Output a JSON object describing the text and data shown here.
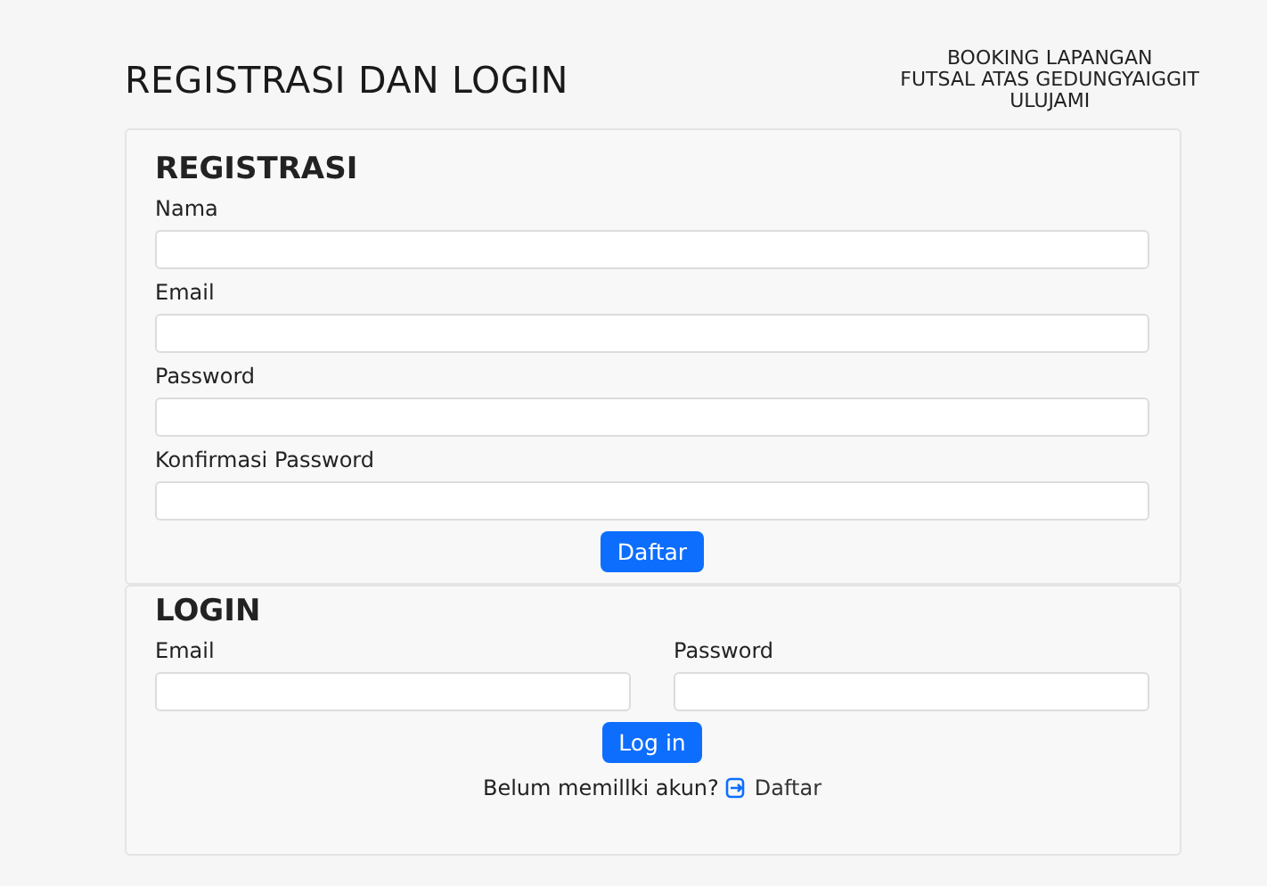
{
  "header": {
    "title": "REGISTRASI DAN LOGIN",
    "subtitle_lines": [
      "BOOKING LAPANGAN",
      "FUTSAL ATAS GEDUNGYAIGGIT",
      "ULUJAMI"
    ]
  },
  "registration": {
    "heading": "REGISTRASI",
    "fields": [
      {
        "label": "Nama"
      },
      {
        "label": "Email"
      },
      {
        "label": "Password"
      },
      {
        "label": "Konfirmasi Password"
      }
    ],
    "button": "Daftar"
  },
  "login": {
    "heading": "LOGIN",
    "fields": [
      {
        "label": "Email"
      },
      {
        "label": "Password"
      }
    ],
    "button": "Log in",
    "prompt": "Belum memillki akun?",
    "link": "Daftar"
  }
}
